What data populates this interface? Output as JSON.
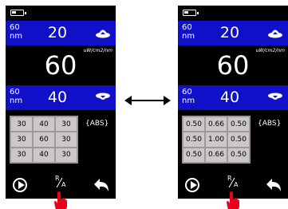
{
  "left_screen": {
    "top_band": {
      "wavelength": "60",
      "wavelength_unit": "nm",
      "value": "20"
    },
    "unit_label": "uW/cm2/nm",
    "main_value": "60",
    "bottom_band": {
      "wavelength": "60",
      "wavelength_unit": "nm",
      "value": "40"
    },
    "grid": [
      "30",
      "40",
      "30",
      "30",
      "60",
      "30",
      "30",
      "40",
      "30"
    ],
    "mode_label": "{ABS}",
    "ra_label": {
      "r": "R",
      "a": "A"
    }
  },
  "right_screen": {
    "top_band": {
      "wavelength": "60",
      "wavelength_unit": "nm",
      "value": "20"
    },
    "unit_label": "uW/cm2/nm",
    "main_value": "60",
    "bottom_band": {
      "wavelength": "60",
      "wavelength_unit": "nm",
      "value": "40"
    },
    "grid": [
      "0.50",
      "0.66",
      "0.50",
      "0.50",
      "1.00",
      "0.50",
      "0.50",
      "0.66",
      "0.50"
    ],
    "mode_label": "{ABS}",
    "ra_label": {
      "r": "R",
      "a": "A"
    }
  },
  "colors": {
    "band_blue": "#1010c8",
    "screen_black": "#000000",
    "grid_cell": "#cdc7c7",
    "touch_red": "#e8001c"
  },
  "icons": {
    "battery": "battery-icon",
    "lamp_up": "lamp-up-icon",
    "lamp_down": "lamp-down-icon",
    "play": "play-icon",
    "back": "back-arrow-icon",
    "touch": "touch-hand-icon",
    "swap": "double-arrow-icon"
  }
}
